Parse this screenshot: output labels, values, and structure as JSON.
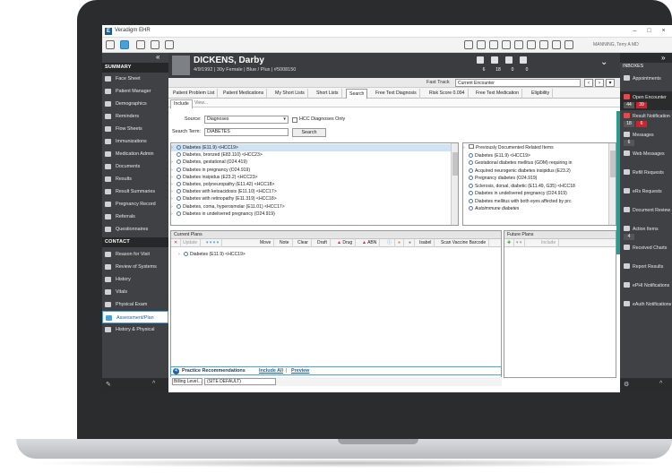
{
  "app": {
    "title": "Veradigm EHR",
    "user": "MANNING, Terry A MD"
  },
  "patient": {
    "name": "DICKENS, Darby",
    "demographics": "4/9/1992 | 30y Female | Blue / Plus | #5008150",
    "counts": [
      "6",
      "18",
      "0",
      "0"
    ]
  },
  "fast_track": {
    "label": "Fast Track",
    "value": "Current Encounter"
  },
  "tabs": [
    "Patient Problem List",
    "Patient Medications",
    "My Short Lists",
    "Short Lists",
    "Search",
    "Free Text Diagnosis",
    "Risk Score  0.094",
    "Free Text Medication",
    "Eligibility"
  ],
  "subtabs": [
    "Include",
    "View..."
  ],
  "search": {
    "source_label": "Source:",
    "source_value": "Diagnoses",
    "hcc_label": "HCC Diagnoses Only",
    "term_label": "Search Term:",
    "term_value": "DIABETES",
    "search_button": "Search"
  },
  "results": [
    "Diabetes (E11.9) <HCC19>",
    "Diabetes, bronzed (E83.110) <HCC23>",
    "Diabetes, gestational (O24.419)",
    "Diabetes in pregnancy (O24.919)",
    "Diabetes insipidus (E23.2) <HCC23>",
    "Diabetes, polyneuropathy (E11.42) <HCC18>",
    "Diabetes with ketoacidosis (E11.10) <HCC17>",
    "Diabetes with retinopathy (E11.319) <HCC18>",
    "Diabetes, coma, hyperosmolar (E11.01) <HCC17>",
    "Diabetes in undelivered pregnancy (O24.919)"
  ],
  "related": {
    "header": "Previously Documented Related Items",
    "items": [
      "Diabetes (E11.9) <HCC19>",
      "Gestational diabetes mellitus (GDM) requiring in",
      "Acquired neurogenic diabetes insipidus (E23.2)",
      "Pregnancy diabetes (O24.919)",
      "Sclerosis, dorsal, diabetic (E11.49, G35) <HCC18",
      "Diabetes in undelivered pregnancy (O24.919)",
      "Diabetes mellitus with both eyes affected by prc",
      "Autoimmune diabetes"
    ]
  },
  "current_plans": {
    "label": "Current Plans",
    "toolbar": [
      "Update",
      "Move",
      "Note",
      "Clear",
      "Draft",
      "Drug",
      "ABN",
      "Isabel",
      "Scan Vaccine Barcode"
    ],
    "items": [
      "Diabetes (E11.9) <HCC19>"
    ]
  },
  "future_plans": {
    "label": "Future Plans",
    "toolbar": [
      "Include"
    ]
  },
  "practice_rec": {
    "count": "4",
    "label": "Practice Recommendations",
    "include_all": "Include All",
    "sep": "|",
    "preview": "Preview"
  },
  "billing": {
    "label": "Billing Level...",
    "value": "(SITE DEFAULT)"
  },
  "sidebar": {
    "summary_label": "SUMMARY",
    "summary_items": [
      "Face Sheet",
      "Patient Manager",
      "Demographics",
      "Reminders",
      "Flow Sheets",
      "Immunizations",
      "Medication Admin",
      "Documents",
      "Results",
      "Result Summaries",
      "Pregnancy Record",
      "Referrals",
      "Questionnaires"
    ],
    "contact_label": "CONTACT",
    "contact_items": [
      "Reason for Visit",
      "Review of Systems",
      "History",
      "Vitals",
      "Physical Exam",
      "Assessment/Plan",
      "History & Physical"
    ]
  },
  "inboxes": {
    "label": "INBOXES",
    "items": [
      {
        "label": "Appointments"
      },
      {
        "label": "Open Encounter",
        "a": "44",
        "b": "39"
      },
      {
        "label": "Result Notification",
        "a": "18",
        "b": "6"
      },
      {
        "label": "Messages",
        "a": "6"
      },
      {
        "label": "Web Messages"
      },
      {
        "label": "Refill Requests"
      },
      {
        "label": "eRx Requests"
      },
      {
        "label": "Document Review"
      },
      {
        "label": "Action Items",
        "a": "4"
      },
      {
        "label": "Received Charts"
      },
      {
        "label": "Report Results"
      },
      {
        "label": "ePHI Notifications"
      },
      {
        "label": "eAuth Notifications"
      }
    ]
  }
}
